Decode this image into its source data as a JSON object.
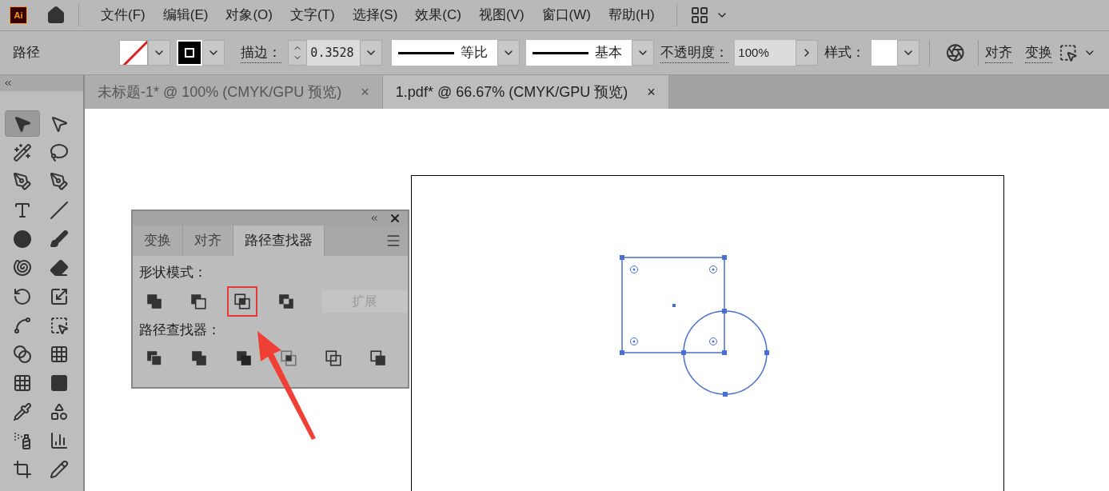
{
  "menu_bar": {
    "logo": "Ai",
    "items": [
      "文件(F)",
      "编辑(E)",
      "对象(O)",
      "文字(T)",
      "选择(S)",
      "效果(C)",
      "视图(V)",
      "窗口(W)",
      "帮助(H)"
    ]
  },
  "control_bar": {
    "object_type": "路径",
    "stroke_label": "描边：",
    "stroke_weight": "0.3528",
    "profile": "等比",
    "brush": "基本",
    "opacity_label": "不透明度：",
    "opacity": "100%",
    "style_label": "样式：",
    "align_link": "对齐",
    "transform_link": "变换"
  },
  "tools": [
    {
      "selected": true
    },
    {
      "selected": false
    },
    {
      "selected": false
    },
    {
      "selected": false
    },
    {
      "selected": false
    },
    {
      "selected": false
    },
    {
      "selected": false
    },
    {
      "selected": false
    },
    {
      "selected": false
    },
    {
      "selected": false
    },
    {
      "selected": false
    },
    {
      "selected": false
    },
    {
      "selected": false
    },
    {
      "selected": false
    },
    {
      "selected": false
    },
    {
      "selected": false
    },
    {
      "selected": false
    },
    {
      "selected": false
    },
    {
      "selected": false
    },
    {
      "selected": false
    },
    {
      "selected": false
    },
    {
      "selected": false
    },
    {
      "selected": false
    },
    {
      "selected": false
    },
    {
      "selected": false
    },
    {
      "selected": false
    }
  ],
  "document_tabs": [
    {
      "title": "未标题-1* @ 100% (CMYK/GPU 预览)",
      "close": "×",
      "selected": false
    },
    {
      "title": "1.pdf* @  66.67% (CMYK/GPU 预览)",
      "close": "×",
      "selected": true
    }
  ],
  "pathfinder_panel": {
    "tabs": [
      {
        "label": "变换",
        "selected": false
      },
      {
        "label": "对齐",
        "selected": false
      },
      {
        "label": "路径查找器",
        "selected": true
      }
    ],
    "shape_modes_label": "形状模式：",
    "shape_modes": [
      {
        "highlighted": false
      },
      {
        "highlighted": false
      },
      {
        "highlighted": true
      },
      {
        "highlighted": false
      }
    ],
    "expand_button": {
      "label": "扩展",
      "disabled": true
    },
    "pathfinders_label": "路径查找器：",
    "pathfinders": [
      {
        "highlighted": false
      },
      {
        "highlighted": false
      },
      {
        "highlighted": false
      },
      {
        "highlighted": false
      },
      {
        "highlighted": false
      },
      {
        "highlighted": false
      }
    ]
  }
}
